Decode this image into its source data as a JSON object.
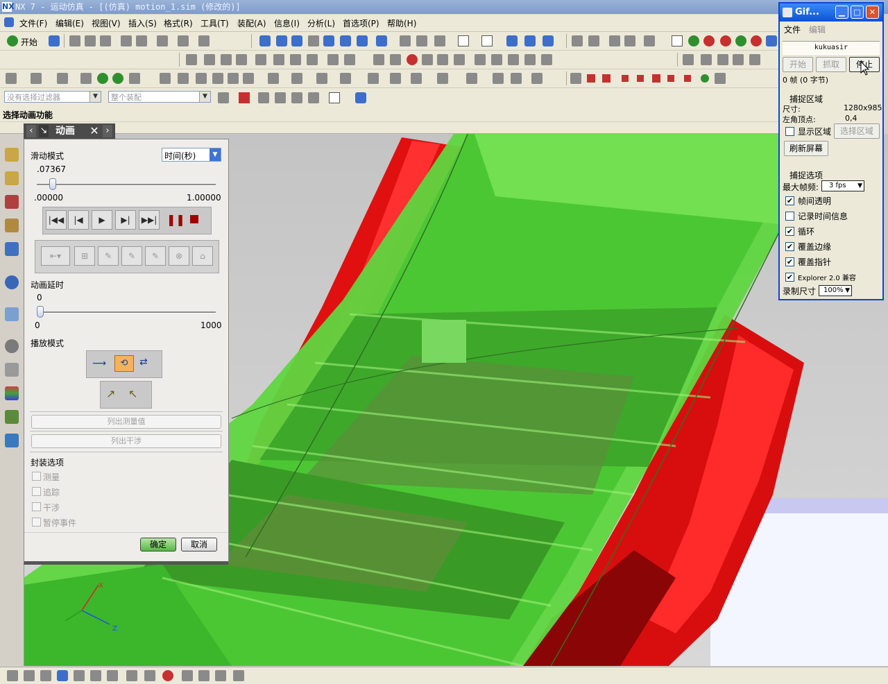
{
  "window": {
    "title": "NX 7 - 运动仿真 - [(仿真) motion_1.sim (修改的)]",
    "logo": "NX"
  },
  "menu": [
    "文件(F)",
    "编辑(E)",
    "视图(V)",
    "插入(S)",
    "格式(R)",
    "工具(T)",
    "装配(A)",
    "信息(I)",
    "分析(L)",
    "首选项(P)",
    "帮助(H)"
  ],
  "toolbar": {
    "start_label": "开始"
  },
  "filters": {
    "selection_filter": "没有选择过滤器",
    "assembly_scope": "整个装配"
  },
  "cue_line": "选择动画功能",
  "dialog": {
    "title": "动画",
    "slide_mode_label": "滑动模式",
    "slide_mode_value": "时间(秒)",
    "time_value": ".07367",
    "time_position": 0.07367,
    "time_min": ".00000",
    "time_max": "1.00000",
    "delay_label": "动画延时",
    "delay_value": "0",
    "delay_min": "0",
    "delay_max": "1000",
    "playback_label": "播放模式",
    "list_measure": "列出测量值",
    "list_interference": "列出干涉",
    "package_label": "封装选项",
    "package_options": [
      "测量",
      "追踪",
      "干涉",
      "暂停事件"
    ],
    "ok": "确定",
    "cancel": "取消"
  },
  "gif": {
    "title": "Gif...",
    "menu_file": "文件",
    "menu_edit": "编辑",
    "brand": "kukuasir",
    "btn_start": "开始",
    "btn_capture": "抓取",
    "btn_stop": "停止",
    "frames": "0 帧 (0 字节)",
    "capture_area": "捕捉区域",
    "size_label": "尺寸:",
    "size_value": "1280x985",
    "corner_label": "左角顶点:",
    "corner_value": "0,4",
    "show_area": "显示区域",
    "select_area": "选择区域",
    "refresh": "刷新屏幕",
    "capture_opts": "捕捉选项",
    "fps_label": "最大帧频:",
    "fps_value": "3 fps",
    "options": [
      {
        "label": "帧间透明",
        "checked": true
      },
      {
        "label": "记录时间信息",
        "checked": false
      },
      {
        "label": "循环",
        "checked": true
      },
      {
        "label": "覆盖边缘",
        "checked": true
      },
      {
        "label": "覆盖指针",
        "checked": true
      },
      {
        "label": "Explorer 2.0 兼容",
        "checked": true
      }
    ],
    "rec_size_label": "录制尺寸",
    "rec_size_value": "100%"
  },
  "colors": {
    "gear_green": "#55d43a",
    "gear_red": "#e80f0f",
    "dialog_head": "#4b4b4b",
    "xp_blue": "#0a52d8"
  }
}
